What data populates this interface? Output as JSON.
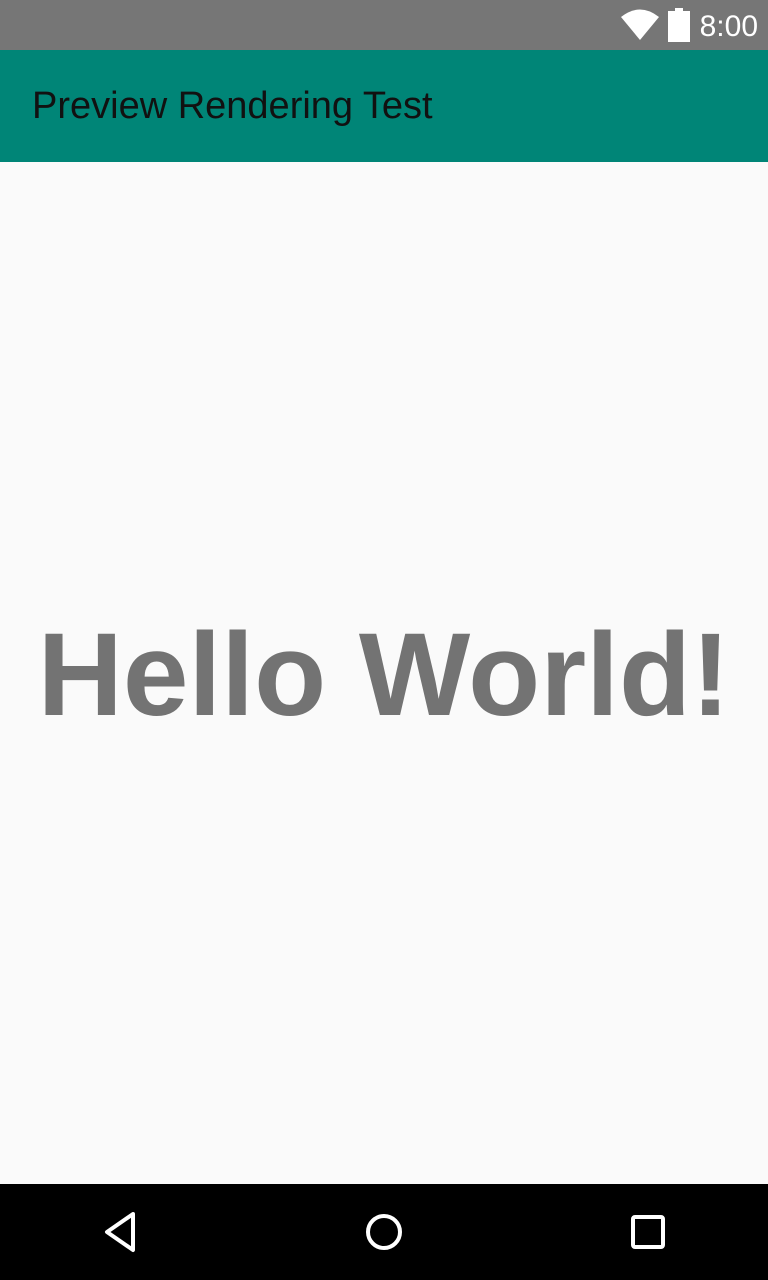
{
  "status_bar": {
    "time": "8:00",
    "icons": [
      "wifi-icon",
      "battery-icon"
    ],
    "background_color": "#767676"
  },
  "app_bar": {
    "title": "Preview Rendering Test",
    "background_color": "#008577"
  },
  "main": {
    "text": "Hello World!",
    "text_color": "#737373"
  },
  "nav_bar": {
    "buttons": [
      "back-icon",
      "home-icon",
      "recents-icon"
    ],
    "background_color": "#000000"
  }
}
